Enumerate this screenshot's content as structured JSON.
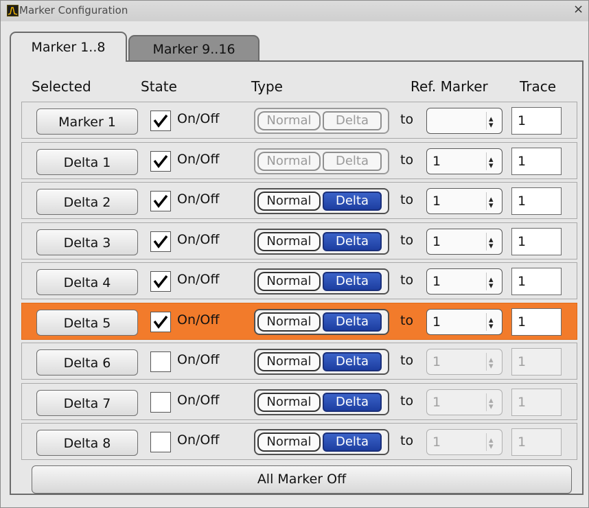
{
  "window": {
    "title": "Marker Configuration",
    "close_symbol": "×"
  },
  "tabs": [
    {
      "label": "Marker 1..8",
      "active": true
    },
    {
      "label": "Marker 9..16",
      "active": false
    }
  ],
  "headers": {
    "selected": "Selected",
    "state": "State",
    "type": "Type",
    "ref_marker": "Ref. Marker",
    "trace": "Trace"
  },
  "type_labels": {
    "normal": "Normal",
    "delta": "Delta"
  },
  "state_label": "On/Off",
  "to_label": "to",
  "rows": [
    {
      "name": "Marker 1",
      "checked": true,
      "type": "disabled",
      "ref": "",
      "ref_enabled": true,
      "trace": "1",
      "trace_enabled": true,
      "highlighted": false
    },
    {
      "name": "Delta 1",
      "checked": true,
      "type": "disabled",
      "ref": "1",
      "ref_enabled": true,
      "trace": "1",
      "trace_enabled": true,
      "highlighted": false
    },
    {
      "name": "Delta 2",
      "checked": true,
      "type": "delta",
      "ref": "1",
      "ref_enabled": true,
      "trace": "1",
      "trace_enabled": true,
      "highlighted": false
    },
    {
      "name": "Delta 3",
      "checked": true,
      "type": "delta",
      "ref": "1",
      "ref_enabled": true,
      "trace": "1",
      "trace_enabled": true,
      "highlighted": false
    },
    {
      "name": "Delta 4",
      "checked": true,
      "type": "delta",
      "ref": "1",
      "ref_enabled": true,
      "trace": "1",
      "trace_enabled": true,
      "highlighted": false
    },
    {
      "name": "Delta 5",
      "checked": true,
      "type": "delta",
      "ref": "1",
      "ref_enabled": true,
      "trace": "1",
      "trace_enabled": true,
      "highlighted": true
    },
    {
      "name": "Delta 6",
      "checked": false,
      "type": "delta",
      "ref": "1",
      "ref_enabled": false,
      "trace": "1",
      "trace_enabled": false,
      "highlighted": false
    },
    {
      "name": "Delta 7",
      "checked": false,
      "type": "delta",
      "ref": "1",
      "ref_enabled": false,
      "trace": "1",
      "trace_enabled": false,
      "highlighted": false
    },
    {
      "name": "Delta 8",
      "checked": false,
      "type": "delta",
      "ref": "1",
      "ref_enabled": false,
      "trace": "1",
      "trace_enabled": false,
      "highlighted": false
    }
  ],
  "all_off_label": "All Marker Off",
  "colors": {
    "highlight": "#f27b2b",
    "delta_active": "#2447b0",
    "background": "#e7e7e7"
  },
  "icons": {
    "app": "app-spectrum-icon",
    "close": "close-icon",
    "check": "checkmark-icon",
    "spinner": "spinner-arrows-icon"
  }
}
